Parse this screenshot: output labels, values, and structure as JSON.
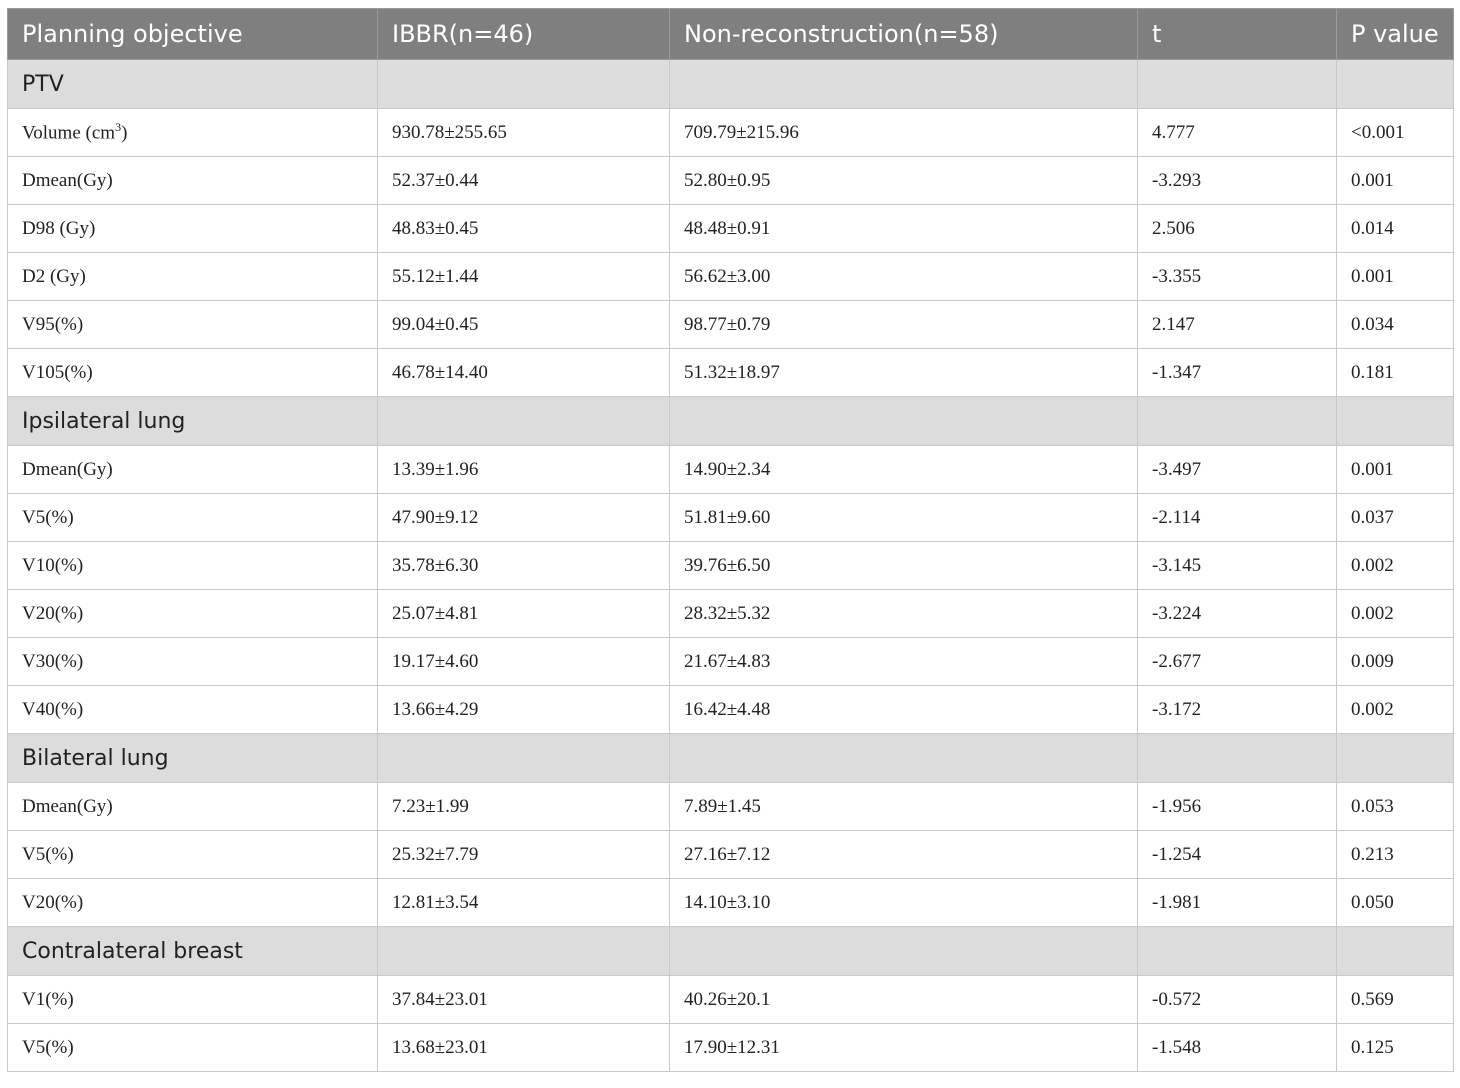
{
  "table": {
    "headers": [
      "Planning objective",
      "IBBR(n=46)",
      "Non-reconstruction(n=58)",
      "t",
      "P value"
    ],
    "sections": [
      {
        "title": "PTV",
        "rows": [
          {
            "label": "Volume (cm",
            "label_sup": "3",
            "label_suffix": ")",
            "ibbr": "930.78±255.65",
            "non": "709.79±215.96",
            "t": "4.777",
            "p": "<0.001"
          },
          {
            "label": "Dmean(Gy)",
            "ibbr": "52.37±0.44",
            "non": "52.80±0.95",
            "t": "-3.293",
            "p": "0.001"
          },
          {
            "label": "D98 (Gy)",
            "ibbr": "48.83±0.45",
            "non": "48.48±0.91",
            "t": "2.506",
            "p": "0.014"
          },
          {
            "label": "D2 (Gy)",
            "ibbr": "55.12±1.44",
            "non": "56.62±3.00",
            "t": "-3.355",
            "p": "0.001"
          },
          {
            "label": "V95(%)",
            "ibbr": "99.04±0.45",
            "non": "98.77±0.79",
            "t": "2.147",
            "p": "0.034"
          },
          {
            "label": "V105(%)",
            "ibbr": "46.78±14.40",
            "non": "51.32±18.97",
            "t": "-1.347",
            "p": "0.181"
          }
        ]
      },
      {
        "title": "Ipsilateral lung",
        "rows": [
          {
            "label": "Dmean(Gy)",
            "ibbr": "13.39±1.96",
            "non": "14.90±2.34",
            "t": "-3.497",
            "p": "0.001"
          },
          {
            "label": "V5(%)",
            "ibbr": "47.90±9.12",
            "non": "51.81±9.60",
            "t": "-2.114",
            "p": "0.037"
          },
          {
            "label": "V10(%)",
            "ibbr": "35.78±6.30",
            "non": "39.76±6.50",
            "t": "-3.145",
            "p": "0.002"
          },
          {
            "label": "V20(%)",
            "ibbr": "25.07±4.81",
            "non": "28.32±5.32",
            "t": "-3.224",
            "p": "0.002"
          },
          {
            "label": "V30(%)",
            "ibbr": "19.17±4.60",
            "non": "21.67±4.83",
            "t": "-2.677",
            "p": "0.009"
          },
          {
            "label": "V40(%)",
            "ibbr": "13.66±4.29",
            "non": "16.42±4.48",
            "t": "-3.172",
            "p": "0.002"
          }
        ]
      },
      {
        "title": "Bilateral lung",
        "rows": [
          {
            "label": "Dmean(Gy)",
            "ibbr": "7.23±1.99",
            "non": "7.89±1.45",
            "t": "-1.956",
            "p": "0.053"
          },
          {
            "label": "V5(%)",
            "ibbr": "25.32±7.79",
            "non": "27.16±7.12",
            "t": "-1.254",
            "p": "0.213"
          },
          {
            "label": "V20(%)",
            "ibbr": "12.81±3.54",
            "non": "14.10±3.10",
            "t": "-1.981",
            "p": "0.050"
          }
        ]
      },
      {
        "title": "Contralateral breast",
        "rows": [
          {
            "label": "V1(%)",
            "ibbr": "37.84±23.01",
            "non": "40.26±20.1",
            "t": "-0.572",
            "p": "0.569"
          },
          {
            "label": "V5(%)",
            "ibbr": "13.68±23.01",
            "non": "17.90±12.31",
            "t": "-1.548",
            "p": "0.125"
          }
        ]
      }
    ]
  },
  "colors": {
    "header_bg": "#7f7f7f",
    "section_bg": "#dcdcdc",
    "border": "#c9c9c9"
  }
}
